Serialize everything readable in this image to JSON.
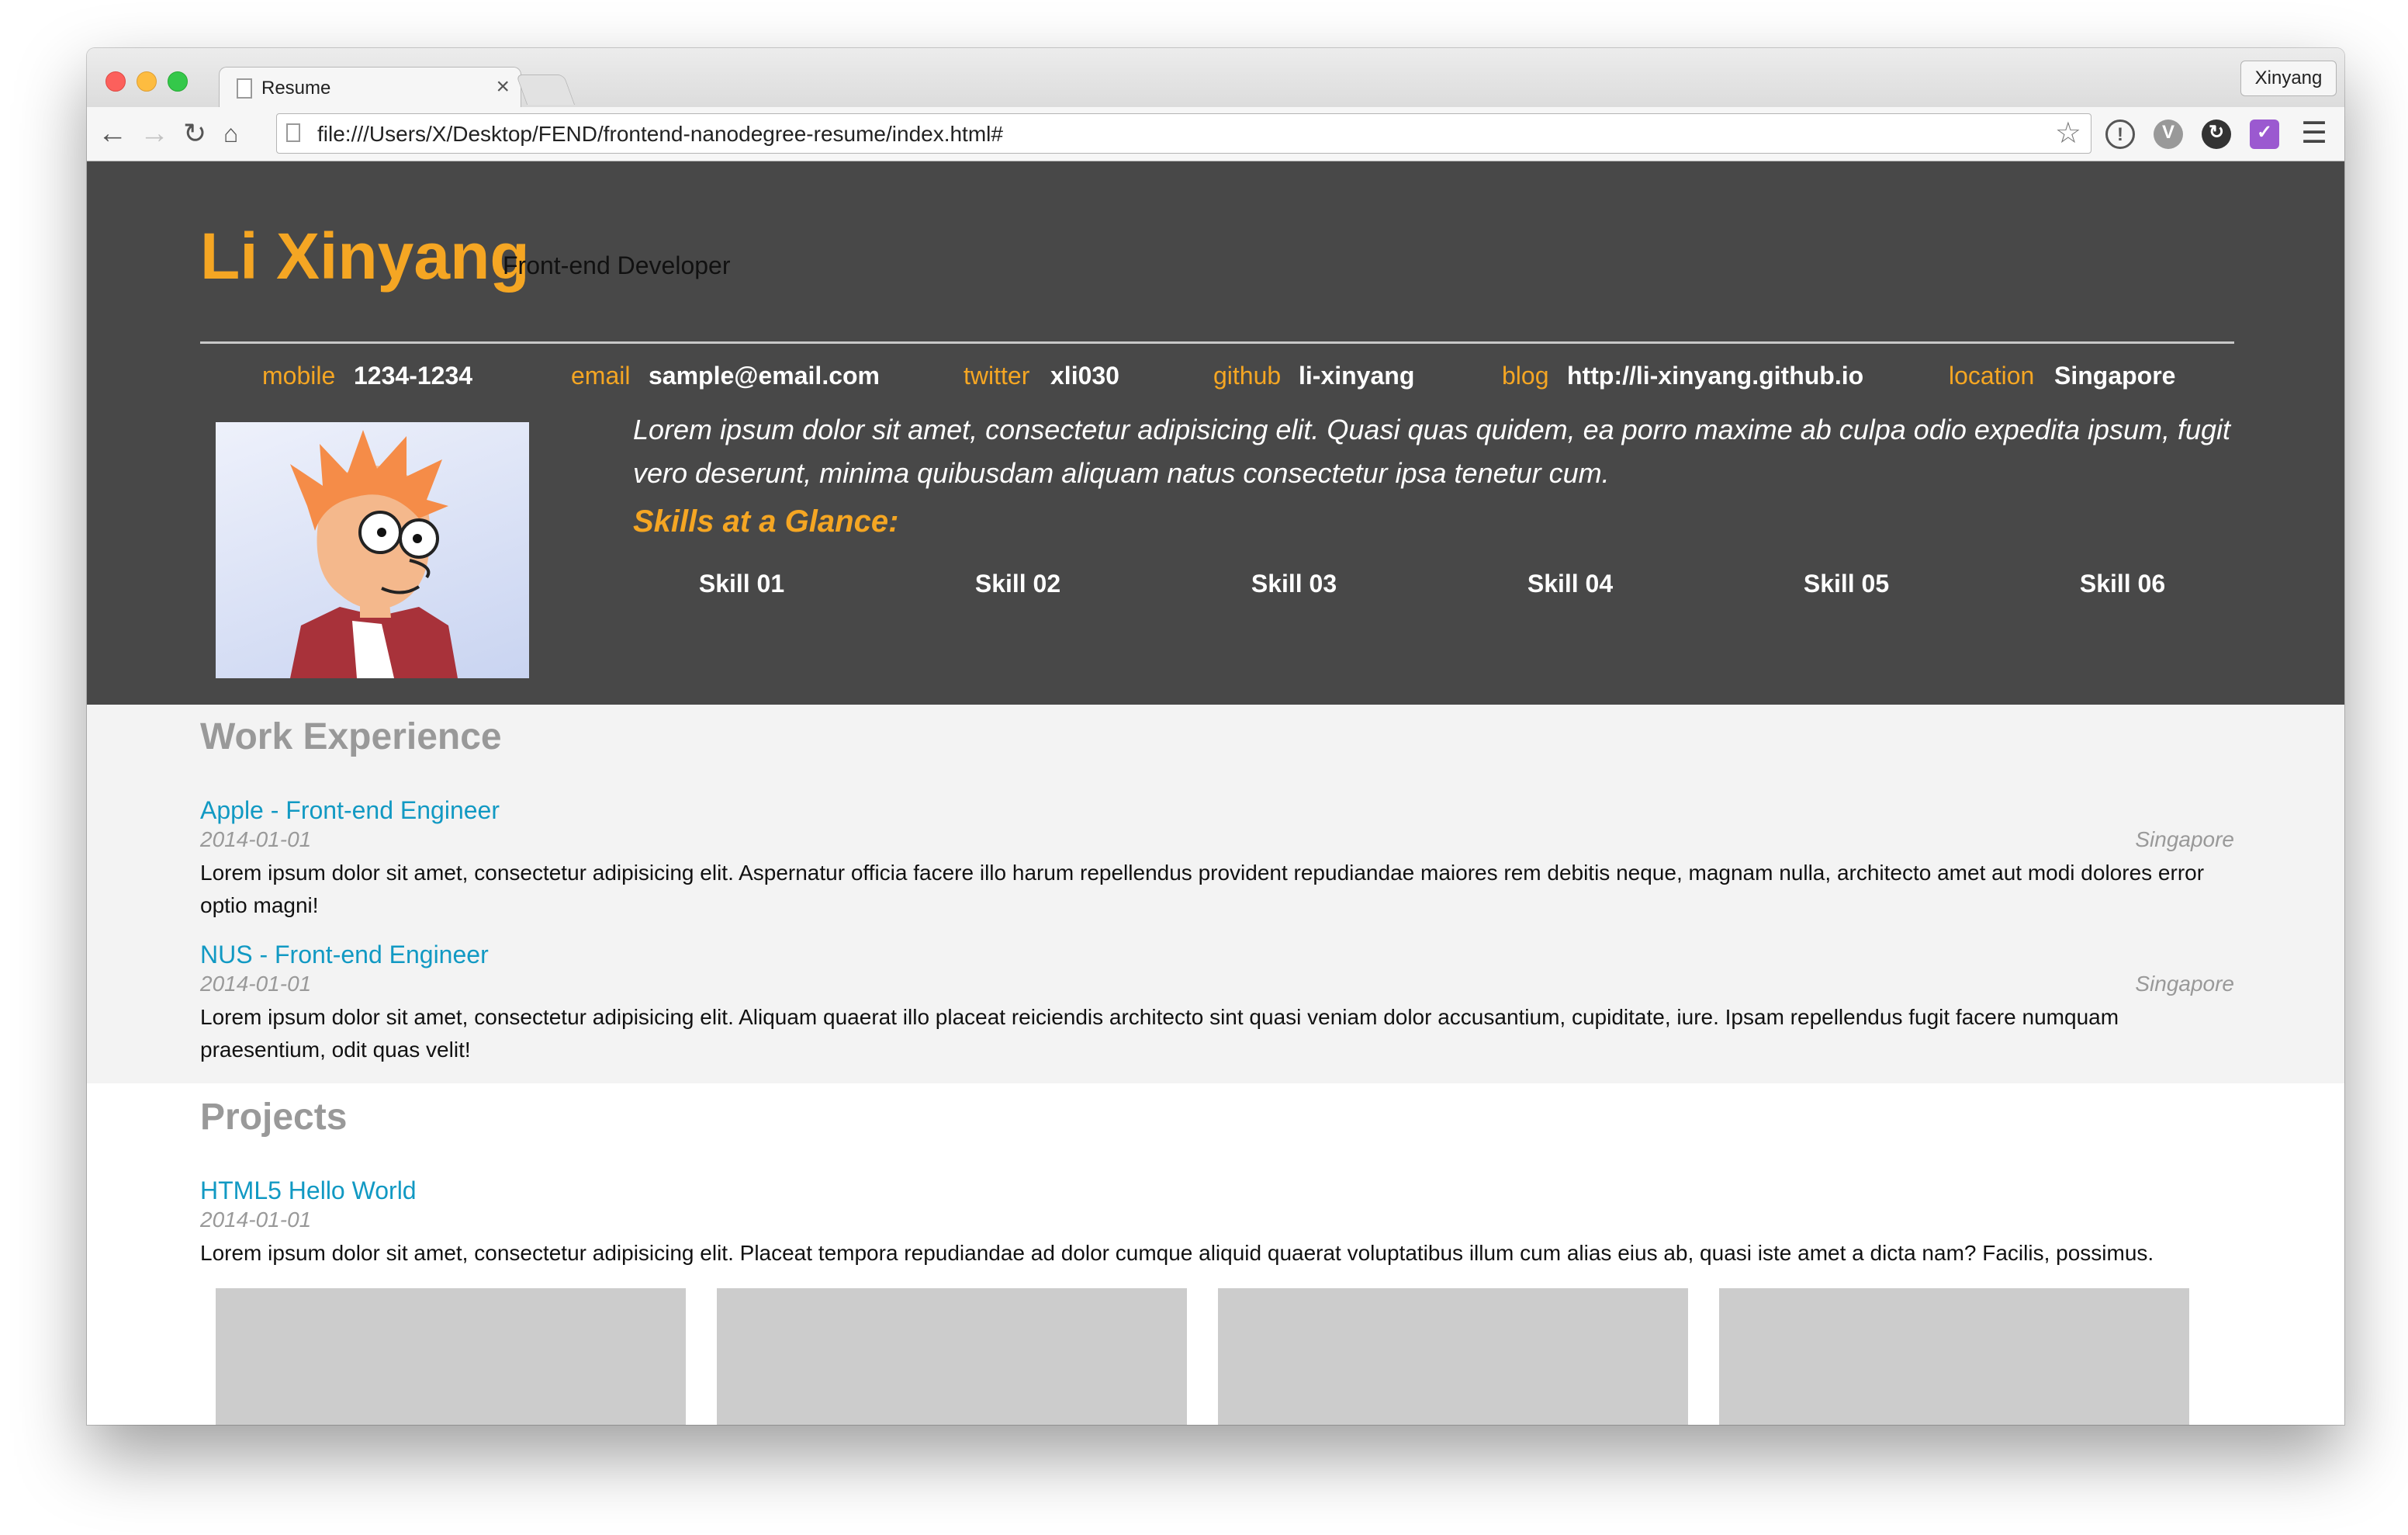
{
  "browser": {
    "tab_title": "Resume",
    "tab_close": "×",
    "profile_name": "Xinyang",
    "url": "file:///Users/X/Desktop/FEND/frontend-nanodegree-resume/index.html#",
    "icons": {
      "back": "arrow-left-icon",
      "forward": "arrow-right-icon",
      "reload": "reload-icon",
      "home": "home-icon",
      "star": "bookmark-star-icon",
      "menu": "hamburger-menu-icon"
    }
  },
  "header": {
    "name": "Li Xinyang",
    "role": "Front-end Developer",
    "contacts": [
      {
        "label": "mobile",
        "value": "1234-1234"
      },
      {
        "label": "email",
        "value": "sample@email.com"
      },
      {
        "label": "twitter",
        "value": "xli030"
      },
      {
        "label": "github",
        "value": "li-xinyang"
      },
      {
        "label": "blog",
        "value": "http://li-xinyang.github.io"
      },
      {
        "label": "location",
        "value": "Singapore"
      }
    ],
    "welcome_message": "Lorem ipsum dolor sit amet, consectetur adipisicing elit. Quasi quas quidem, ea porro maxime ab culpa odio expedita ipsum, fugit vero deserunt, minima quibusdam aliquam natus consectetur ipsa tenetur cum.",
    "skills_heading": "Skills at a Glance:",
    "skills": [
      "Skill 01",
      "Skill 02",
      "Skill 03",
      "Skill 04",
      "Skill 05",
      "Skill 06"
    ]
  },
  "work": {
    "title": "Work Experience",
    "jobs": [
      {
        "title": "Apple - Front-end Engineer",
        "date": "2014-01-01",
        "location": "Singapore",
        "description": "Lorem ipsum dolor sit amet, consectetur adipisicing elit. Aspernatur officia facere illo harum repellendus provident repudiandae maiores rem debitis neque, magnam nulla, architecto amet aut modi dolores error optio magni!"
      },
      {
        "title": "NUS - Front-end Engineer",
        "date": "2014-01-01",
        "location": "Singapore",
        "description": "Lorem ipsum dolor sit amet, consectetur adipisicing elit. Aliquam quaerat illo placeat reiciendis architecto sint quasi veniam dolor accusantium, cupiditate, iure. Ipsam repellendus fugit facere numquam praesentium, odit quas velit!"
      }
    ]
  },
  "projects": {
    "title": "Projects",
    "items": [
      {
        "title": "HTML5 Hello World",
        "date": "2014-01-01",
        "description": "Lorem ipsum dolor sit amet, consectetur adipisicing elit. Placeat tempora repudiandae ad dolor cumque aliquid quaerat voluptatibus illum cum alias eius ab, quasi iste amet a dicta nam? Facilis, possimus."
      }
    ]
  },
  "colors": {
    "accent": "#f5a623",
    "header_bg": "#484848",
    "link": "#1199c3",
    "work_bg": "#f3f3f3"
  }
}
